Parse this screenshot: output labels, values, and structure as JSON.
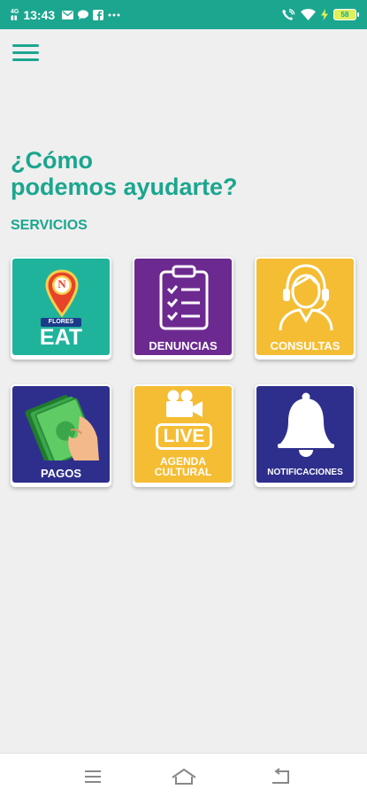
{
  "status_bar": {
    "network": "4G",
    "time": "13:43",
    "notification_icons": [
      "mail-icon",
      "chat-bubble-icon",
      "facebook-icon",
      "more-dots-icon"
    ],
    "battery": "58"
  },
  "header": {
    "menu_icon": "hamburger-menu-icon"
  },
  "headline": {
    "line1": "¿Cómo",
    "line2": "podemos ayudarte?"
  },
  "section_title": "SERVICIOS",
  "tiles": [
    {
      "id": "flores-eat",
      "label": "EAT",
      "sublabel": "FLORES",
      "badge": "N",
      "color": "#20b39c"
    },
    {
      "id": "denuncias",
      "label": "DENUNCIAS",
      "color": "#6c2a91"
    },
    {
      "id": "consultas",
      "label": "CONSULTAS",
      "color": "#f5bd34"
    },
    {
      "id": "pagos",
      "label": "PAGOS",
      "color": "#2e2f8c"
    },
    {
      "id": "agenda-cultural",
      "label": "AGENDA CULTURAL",
      "label_line1": "AGENDA",
      "label_line2": "CULTURAL",
      "live": "LIVE",
      "color": "#f5bd34"
    },
    {
      "id": "notificaciones",
      "label": "NOTIFICACIONES",
      "color": "#2e2f8c"
    }
  ],
  "colors": {
    "primary": "#1ba68f",
    "background": "#efefef"
  },
  "nav_bar": {
    "icons": [
      "recent-apps-icon",
      "home-icon",
      "back-icon"
    ]
  }
}
